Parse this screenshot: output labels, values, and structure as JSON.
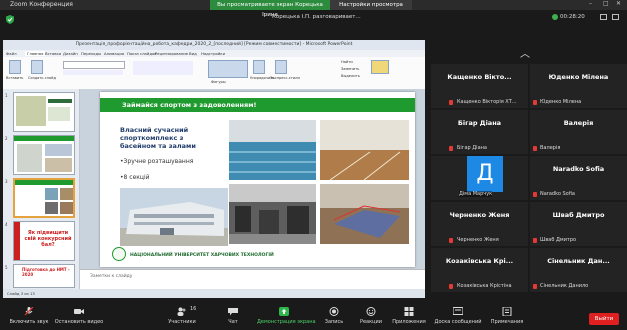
{
  "window": {
    "title": "Zoom Конференция",
    "share_banner": "Вы просматриваете экран Корецька Ірина",
    "view_options": "Настройки просмотра",
    "speaking": "Корецька І.П. разговаривает...",
    "timer": "00:28:20"
  },
  "ppt": {
    "window_title": "Презентація_профорієнтаційна_робота_кафедри_2020_2_[последний] [Режим совместимости] - Microsoft PowerPoint",
    "tabs": [
      "Файл",
      "Главная",
      "Вставка",
      "Дизайн",
      "Переходы",
      "Анимация",
      "Показ слайдов",
      "Рецензирование",
      "Вид",
      "Надстройки"
    ],
    "ribbon": {
      "paste": "Вставить",
      "create_slide": "Создать слайд",
      "shapes": "Фигуры",
      "arrange": "Упорядочить",
      "quick_styles": "Экспресс-стили",
      "find": "Найти",
      "replace": "Заменить",
      "select": "Выделить"
    },
    "thumbs": [
      {
        "num": "1"
      },
      {
        "num": "2"
      },
      {
        "num": "3"
      },
      {
        "num": "4",
        "text": "Як підвищити свій конкурсний бал?"
      },
      {
        "num": "5",
        "text": "Підготовка до НМТ - 2020"
      }
    ],
    "slide": {
      "banner": "Займайся спортом з задоволенням!",
      "heading": "Власний сучасний спорткомплекс з басейном та залами",
      "bullets": [
        "•Зручне розташування",
        "•8 секцій"
      ],
      "footer": "НАЦІОНАЛЬНИЙ УНІВЕРСИТЕТ ХАРЧОВИХ ТЕХНОЛОГІЙ"
    },
    "notes": "Заметки к слайду",
    "status": "Слайд 3 из 13"
  },
  "participants": [
    {
      "big": "Кащенко Вікто...",
      "small": "Кащенко Вікторія ХТ..."
    },
    {
      "big": "Юденко Мілена",
      "small": "Юденко Мілена"
    },
    {
      "big": "Бігар Діана",
      "small": "Бігар Діана"
    },
    {
      "big": "Валерія",
      "small": "Валерія"
    },
    {
      "big": "",
      "small": "Діма Марчук",
      "avatar": "Д"
    },
    {
      "big": "Naradko Sofia",
      "small": "Naradko Sofia"
    },
    {
      "big": "Черненко Женя",
      "small": "Черненко Женя"
    },
    {
      "big": "Шваб Дмитро",
      "small": "Шваб Дмитро"
    },
    {
      "big": "Козаківська Крі...",
      "small": "Козаківська Крістіна"
    },
    {
      "big": "Сінельник Дан...",
      "small": "Сінельник Данило"
    }
  ],
  "toolbar": {
    "mic": "Включить звук",
    "video": "Остановить видео",
    "participants": "Участники",
    "participants_count": "16",
    "chat": "Чат",
    "share": "Демонстрация экрана",
    "record": "Запись",
    "reactions": "Реакции",
    "apps": "Приложения",
    "whiteboard": "Доска сообщений",
    "notes": "Примечания",
    "end": "Выйти"
  },
  "colors": {
    "green": "#1e9a2e",
    "red": "#e02020",
    "blue": "#1e88e5"
  }
}
